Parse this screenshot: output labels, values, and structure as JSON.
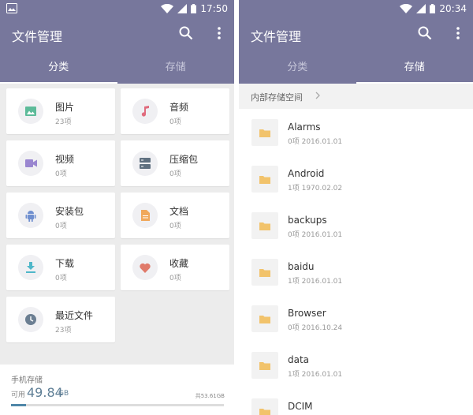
{
  "left": {
    "status_time": "17:50",
    "title": "文件管理",
    "tabs": [
      {
        "label": "分类",
        "active": true
      },
      {
        "label": "存储",
        "active": false
      }
    ],
    "categories": [
      {
        "name": "图片",
        "count": "23项",
        "icon": "image-icon",
        "color": "#5dbb9a"
      },
      {
        "name": "音频",
        "count": "0项",
        "icon": "music-note-icon",
        "color": "#e06b7d"
      },
      {
        "name": "视频",
        "count": "0项",
        "icon": "video-icon",
        "color": "#9a86d0"
      },
      {
        "name": "压缩包",
        "count": "0项",
        "icon": "archive-icon",
        "color": "#5f7080"
      },
      {
        "name": "安装包",
        "count": "0项",
        "icon": "android-icon",
        "color": "#6f8fcf"
      },
      {
        "name": "文档",
        "count": "0项",
        "icon": "document-icon",
        "color": "#f0a85b"
      },
      {
        "name": "下载",
        "count": "0项",
        "icon": "download-icon",
        "color": "#4fb7c9"
      },
      {
        "name": "收藏",
        "count": "0项",
        "icon": "heart-icon",
        "color": "#e07a6a"
      },
      {
        "name": "最近文件",
        "count": "23项",
        "icon": "clock-icon",
        "color": "#6b7e92"
      }
    ],
    "storage": {
      "title": "手机存储",
      "available_label": "可用",
      "available_value": "49.84",
      "available_unit": "GB",
      "total": "共53.61GB",
      "used_fraction": 0.07
    }
  },
  "right": {
    "status_time": "20:34",
    "title": "文件管理",
    "tabs": [
      {
        "label": "分类",
        "active": false
      },
      {
        "label": "存储",
        "active": true
      }
    ],
    "path": "内部存储空间",
    "files": [
      {
        "name": "Alarms",
        "meta": "0项  2016.01.01"
      },
      {
        "name": "Android",
        "meta": "1项  1970.02.02"
      },
      {
        "name": "backups",
        "meta": "0项  2016.01.01"
      },
      {
        "name": "baidu",
        "meta": "1项  2016.01.01"
      },
      {
        "name": "Browser",
        "meta": "0项  2016.10.24"
      },
      {
        "name": "data",
        "meta": "1项  2016.01.01"
      },
      {
        "name": "DCIM",
        "meta": ""
      }
    ]
  },
  "colors": {
    "appbar": "#77779c",
    "folder": "#f2c36b",
    "storage_accent": "#4f87a8"
  }
}
